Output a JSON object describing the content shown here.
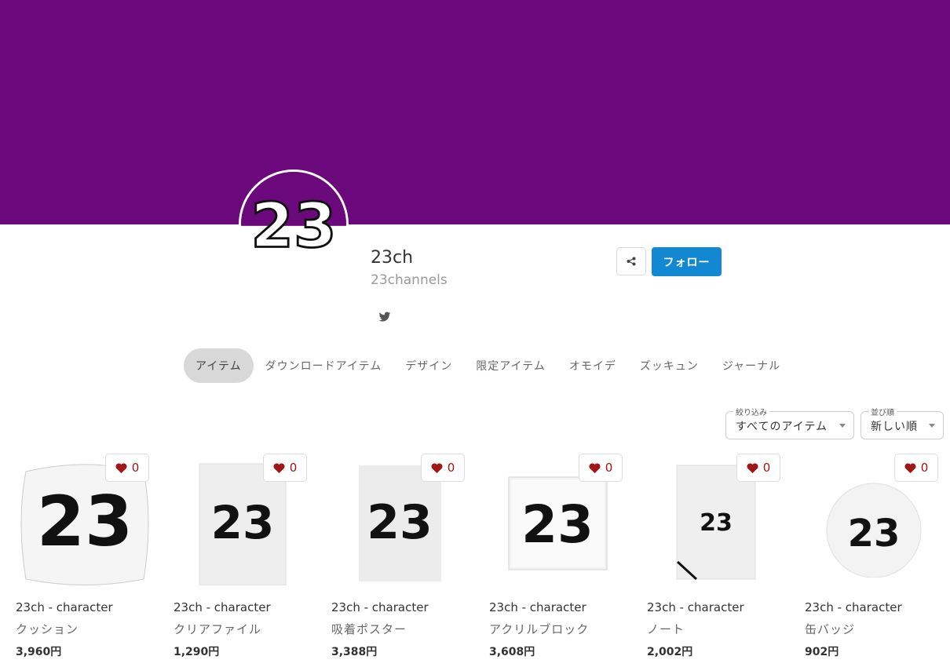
{
  "header": {
    "cover_color": "#6a087c"
  },
  "profile": {
    "name": "23ch",
    "id": "23channels",
    "avatar_text": "23",
    "social": "twitter-icon"
  },
  "actions": {
    "share_icon": "share-icon",
    "follow_label": "フォロー"
  },
  "tabs": [
    {
      "label": "アイテム",
      "active": true
    },
    {
      "label": "ダウンロードアイテム"
    },
    {
      "label": "デザイン"
    },
    {
      "label": "限定アイテム"
    },
    {
      "label": "オモイデ"
    },
    {
      "label": "ズッキュン"
    },
    {
      "label": "ジャーナル"
    }
  ],
  "filters": {
    "filter": {
      "label": "絞り込み",
      "value": "すべてのアイテム"
    },
    "sort": {
      "label": "並び順",
      "value": "新しい順"
    }
  },
  "products": [
    {
      "title": "23ch - character",
      "type": "クッション",
      "price": "3,960円",
      "likes": "0",
      "shape": "cushion",
      "logo": "23"
    },
    {
      "title": "23ch - character",
      "type": "クリアファイル",
      "price": "1,290円",
      "likes": "0",
      "shape": "file",
      "logo": "23"
    },
    {
      "title": "23ch - character",
      "type": "吸着ポスター",
      "price": "3,388円",
      "likes": "0",
      "shape": "poster",
      "logo": "23"
    },
    {
      "title": "23ch - character",
      "type": "アクリルブロック",
      "price": "3,608円",
      "likes": "0",
      "shape": "block",
      "logo": "23"
    },
    {
      "title": "23ch - character",
      "type": "ノート",
      "price": "2,002円",
      "likes": "0",
      "shape": "note",
      "logo": "23"
    },
    {
      "title": "23ch - character",
      "type": "缶バッジ",
      "price": "902円",
      "likes": "0",
      "shape": "badge",
      "logo": "23"
    }
  ],
  "colors": {
    "accent": "#1287d2",
    "heart": "#a01616"
  }
}
